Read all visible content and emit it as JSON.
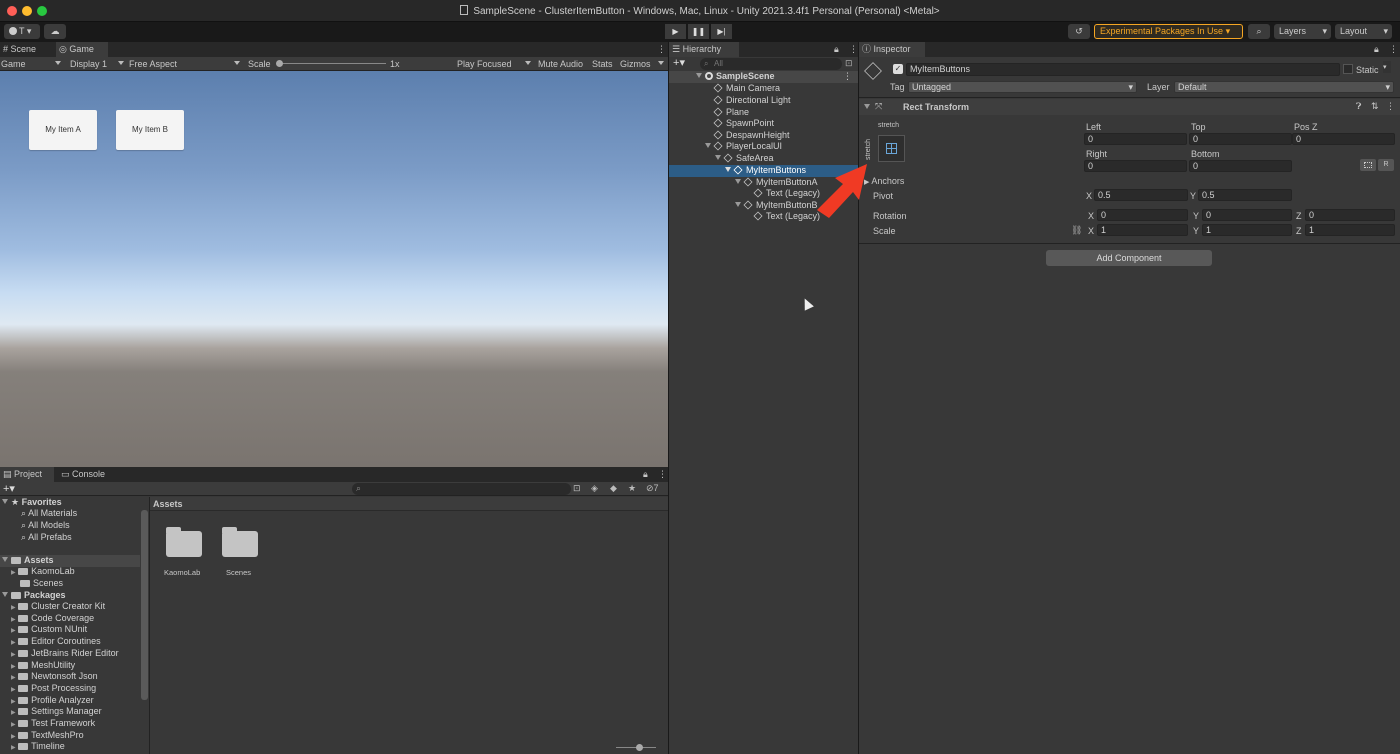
{
  "window": {
    "title": "SampleScene - ClusterItemButton - Windows, Mac, Linux - Unity 2021.3.4f1 Personal (Personal) <Metal>",
    "traffic_colors": [
      "#ff5f57",
      "#febc2e",
      "#28c840"
    ]
  },
  "toolbar": {
    "account_label": "T",
    "experimental_label": "Experimental Packages In Use",
    "layers_label": "Layers",
    "layout_label": "Layout",
    "accent_color": "#f5a623"
  },
  "game": {
    "tabs": {
      "scene": "Scene",
      "game": "Game"
    },
    "toolbar": {
      "mode": "Game",
      "display": "Display 1",
      "aspect": "Free Aspect",
      "scale_label": "Scale",
      "scale_value": "1x",
      "play_focused": "Play Focused",
      "mute_audio": "Mute Audio",
      "stats": "Stats",
      "gizmos": "Gizmos"
    },
    "buttons": {
      "a": "My Item A",
      "b": "My Item B"
    }
  },
  "hierarchy": {
    "tab": "Hierarchy",
    "search_placeholder": "All",
    "scene": "SampleScene",
    "items": {
      "main_camera": "Main Camera",
      "directional_light": "Directional Light",
      "plane": "Plane",
      "spawn_point": "SpawnPoint",
      "despawn_height": "DespawnHeight",
      "player_local_ui": "PlayerLocalUI",
      "safe_area": "SafeArea",
      "my_item_buttons": "MyItemButtons",
      "button_a": "MyItemButtonA",
      "text_a": "Text (Legacy)",
      "button_b": "MyItemButtonB",
      "text_b": "Text (Legacy)"
    }
  },
  "inspector": {
    "tab": "Inspector",
    "object_name": "MyItemButtons",
    "static_label": "Static",
    "tag_label": "Tag",
    "tag_value": "Untagged",
    "layer_label": "Layer",
    "layer_value": "Default",
    "component_title": "Rect Transform",
    "anchor_preset_top": "stretch",
    "anchor_preset_side": "stretch",
    "fields": {
      "left_label": "Left",
      "left": "0",
      "top_label": "Top",
      "top": "0",
      "posz_label": "Pos Z",
      "posz": "0",
      "right_label": "Right",
      "right": "0",
      "bottom_label": "Bottom",
      "bottom": "0"
    },
    "r_button": "R",
    "anchors_label": "Anchors",
    "pivot_label": "Pivot",
    "pivot_x": "0.5",
    "pivot_y": "0.5",
    "rotation_label": "Rotation",
    "rot_x": "0",
    "rot_y": "0",
    "rot_z": "0",
    "scale_label": "Scale",
    "scale_x": "1",
    "scale_y": "1",
    "scale_z": "1",
    "axis": {
      "x": "X",
      "y": "Y",
      "z": "Z"
    },
    "add_component": "Add Component"
  },
  "project": {
    "tabs": {
      "project": "Project",
      "console": "Console"
    },
    "hidden_count": "7",
    "favorites_label": "Favorites",
    "favorites": [
      "All Materials",
      "All Models",
      "All Prefabs"
    ],
    "assets_label": "Assets",
    "assets": [
      "KaomoLab",
      "Scenes"
    ],
    "packages_label": "Packages",
    "packages": [
      "Cluster Creator Kit",
      "Code Coverage",
      "Custom NUnit",
      "Editor Coroutines",
      "JetBrains Rider Editor",
      "MeshUtility",
      "Newtonsoft Json",
      "Post Processing",
      "Profile Analyzer",
      "Settings Manager",
      "Test Framework",
      "TextMeshPro",
      "Timeline"
    ],
    "breadcrumb": "Assets",
    "folders": [
      "KaomoLab",
      "Scenes"
    ]
  },
  "annotation": {
    "arrow_color": "#f03a24"
  }
}
